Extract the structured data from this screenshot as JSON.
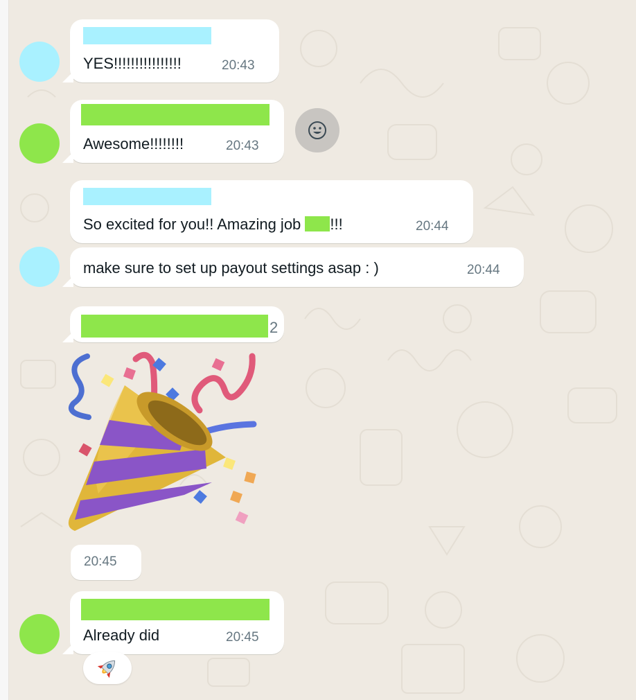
{
  "messages": [
    {
      "text": "YES!!!!!!!!!!!!!!!!",
      "time": "20:43"
    },
    {
      "text": "Awesome!!!!!!!!",
      "time": "20:43"
    },
    {
      "text_before": "So excited for you!! Amazing job",
      "text_after": "!!!",
      "time": "20:44"
    },
    {
      "text": "make sure to set up payout settings asap : )",
      "time": "20:44"
    },
    {
      "sender_suffix": "2"
    },
    {
      "time": "20:45"
    },
    {
      "text": "Already did",
      "time": "20:45"
    }
  ],
  "reaction_icon": "rocket-icon",
  "react_button_icon": "smiley-icon",
  "sticker": "party-popper",
  "colors": {
    "background": "#efeae2",
    "bubble": "#ffffff",
    "redact_blue": "#a9f1ff",
    "redact_green": "#8ee64b",
    "timestamp": "#667781"
  }
}
